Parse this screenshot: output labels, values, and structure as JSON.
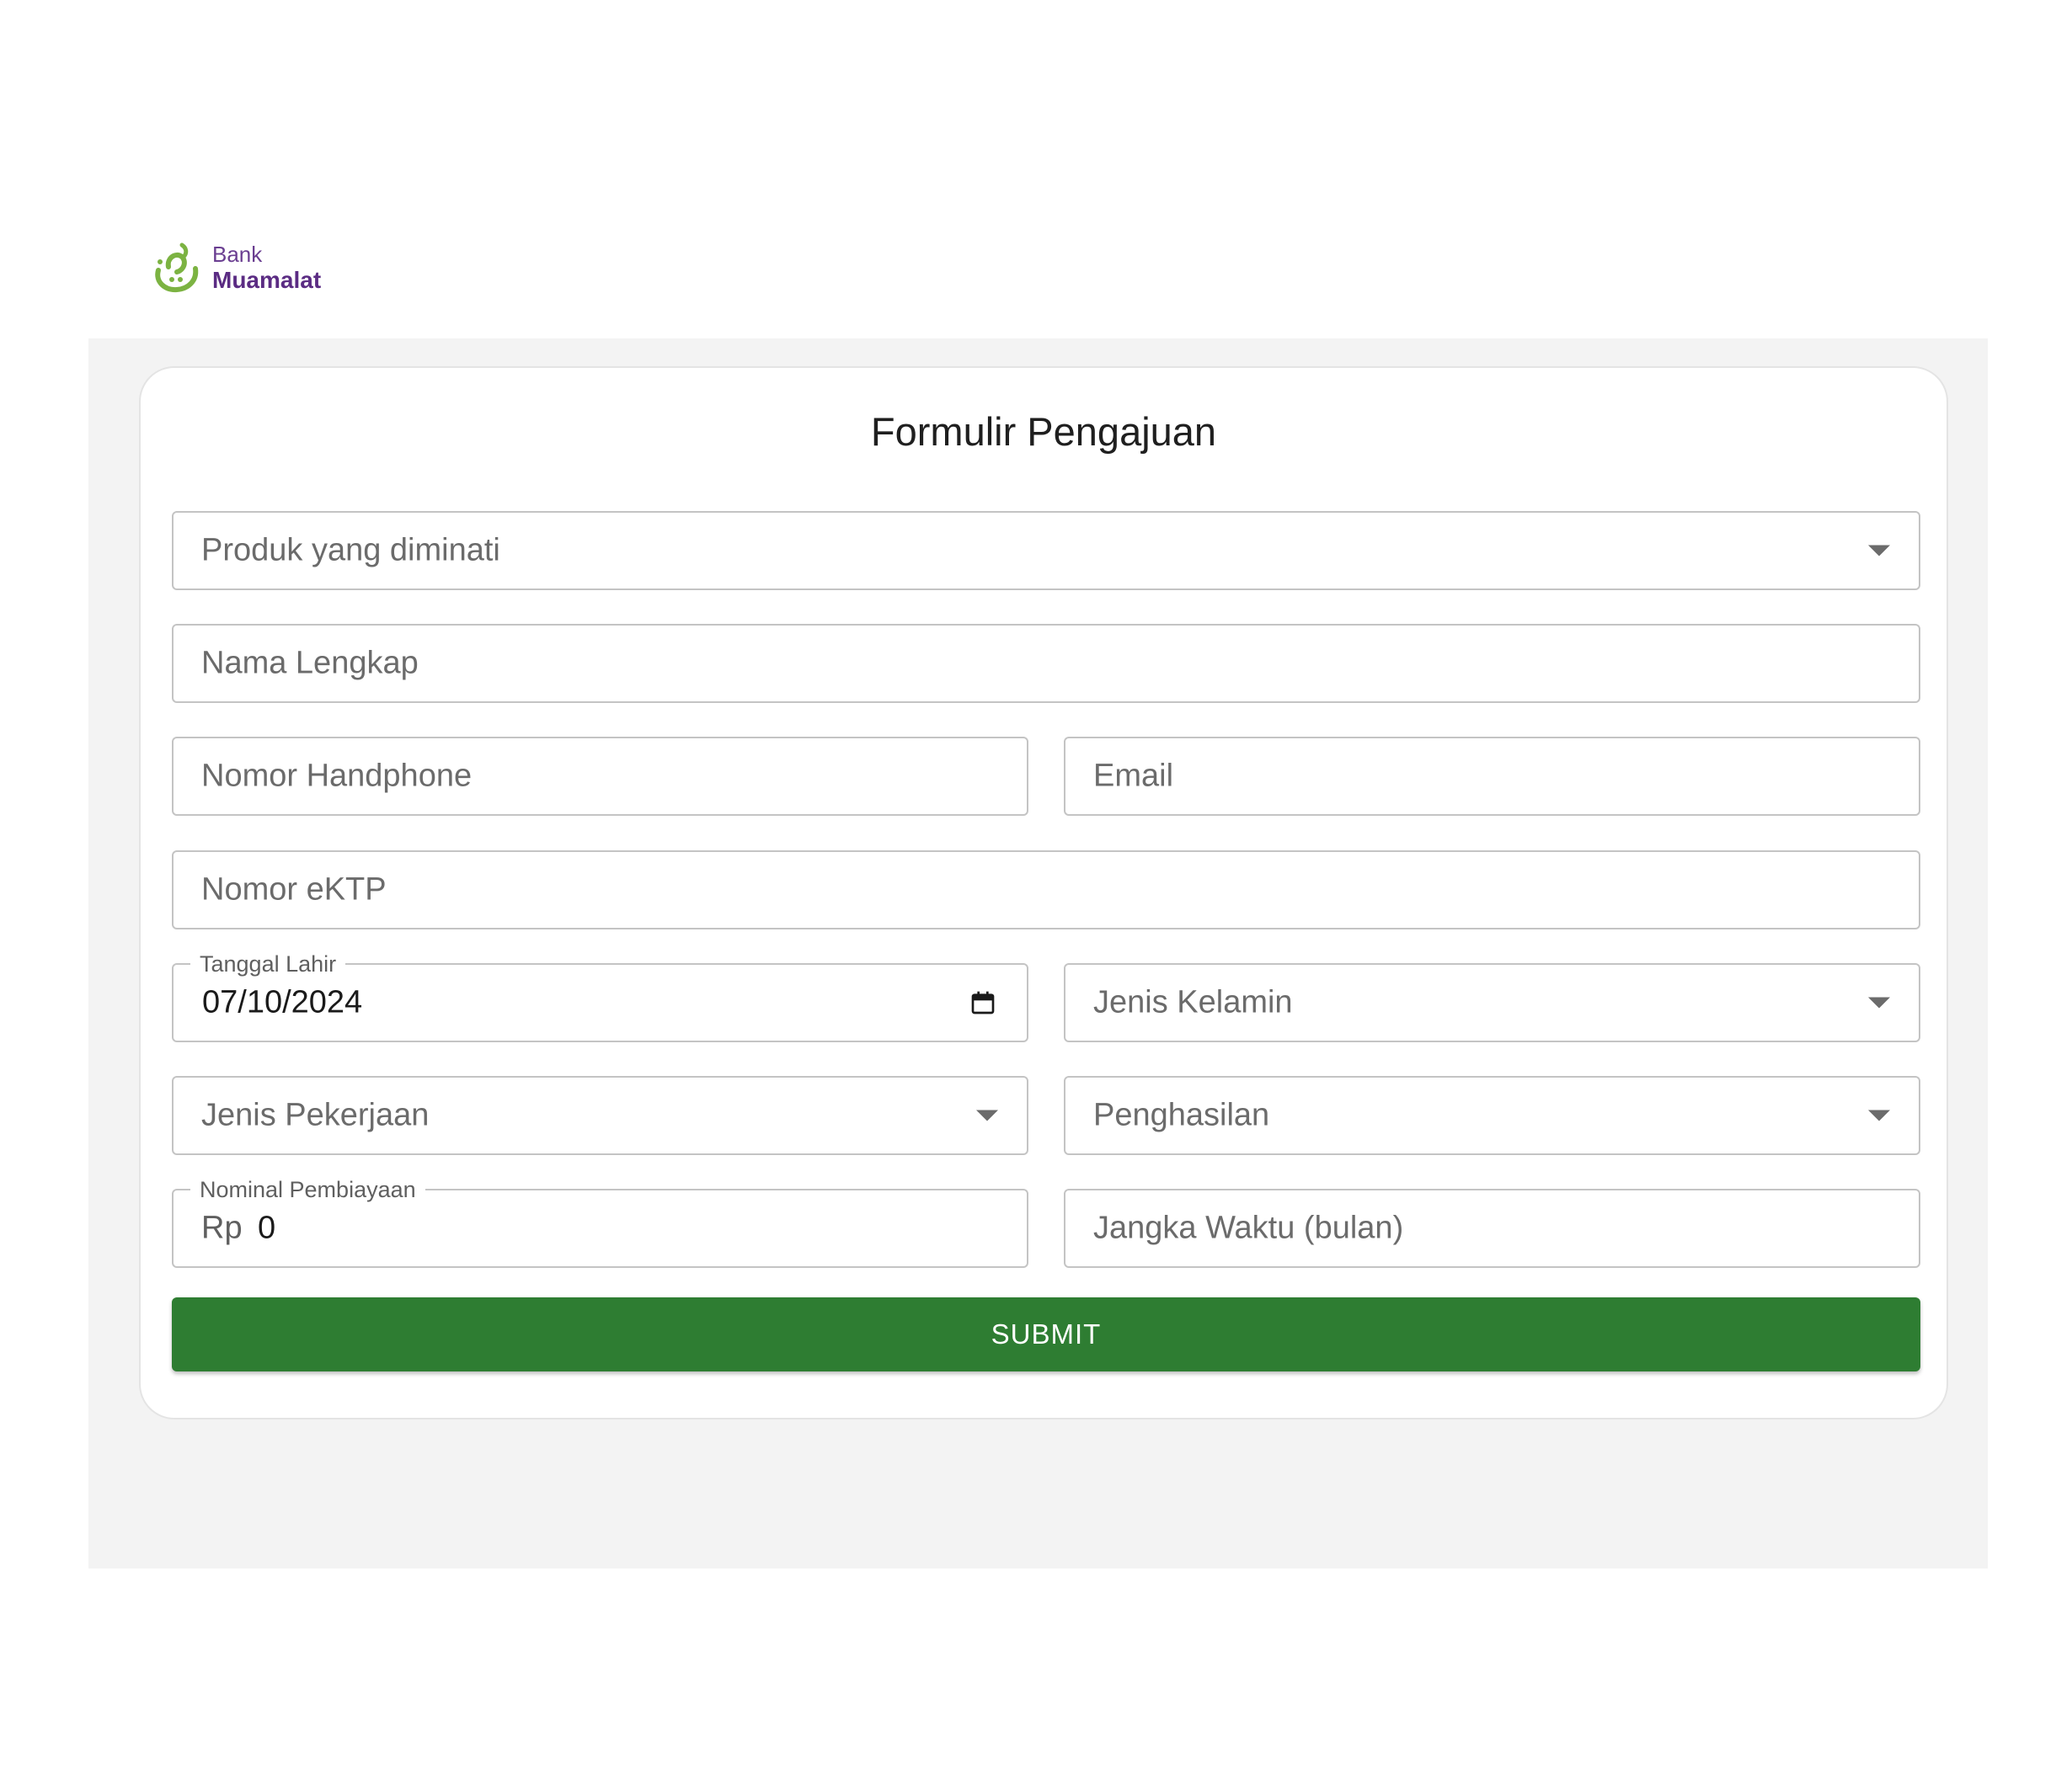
{
  "logo": {
    "line1": "Bank",
    "line2": "Muamalat",
    "mark_icon": "muamalat-logo-icon",
    "brand_green": "#7cb342",
    "brand_purple": "#5b2c83"
  },
  "form": {
    "title": "Formulir Pengajuan",
    "produk": {
      "placeholder": "Produk yang diminati",
      "icon": "chevron-down-icon"
    },
    "nama": {
      "placeholder": "Nama Lengkap"
    },
    "handphone": {
      "placeholder": "Nomor Handphone"
    },
    "email": {
      "placeholder": "Email"
    },
    "ektp": {
      "placeholder": "Nomor eKTP"
    },
    "tanggal_lahir": {
      "label": "Tanggal Lahir",
      "value": "07/10/2024",
      "icon": "calendar-icon"
    },
    "jenis_kelamin": {
      "placeholder": "Jenis Kelamin",
      "icon": "chevron-down-icon"
    },
    "jenis_pekerjaan": {
      "placeholder": "Jenis Pekerjaan",
      "icon": "chevron-down-icon"
    },
    "penghasilan": {
      "placeholder": "Penghasilan",
      "icon": "chevron-down-icon"
    },
    "nominal": {
      "label": "Nominal Pembiayaan",
      "prefix": "Rp",
      "value": "0"
    },
    "jangka_waktu": {
      "placeholder": "Jangka Waktu (bulan)"
    },
    "submit_label": "SUBMIT"
  },
  "colors": {
    "submit_bg": "#2e7d32",
    "band_bg": "#f3f3f3",
    "border": "#c4c4c4"
  }
}
